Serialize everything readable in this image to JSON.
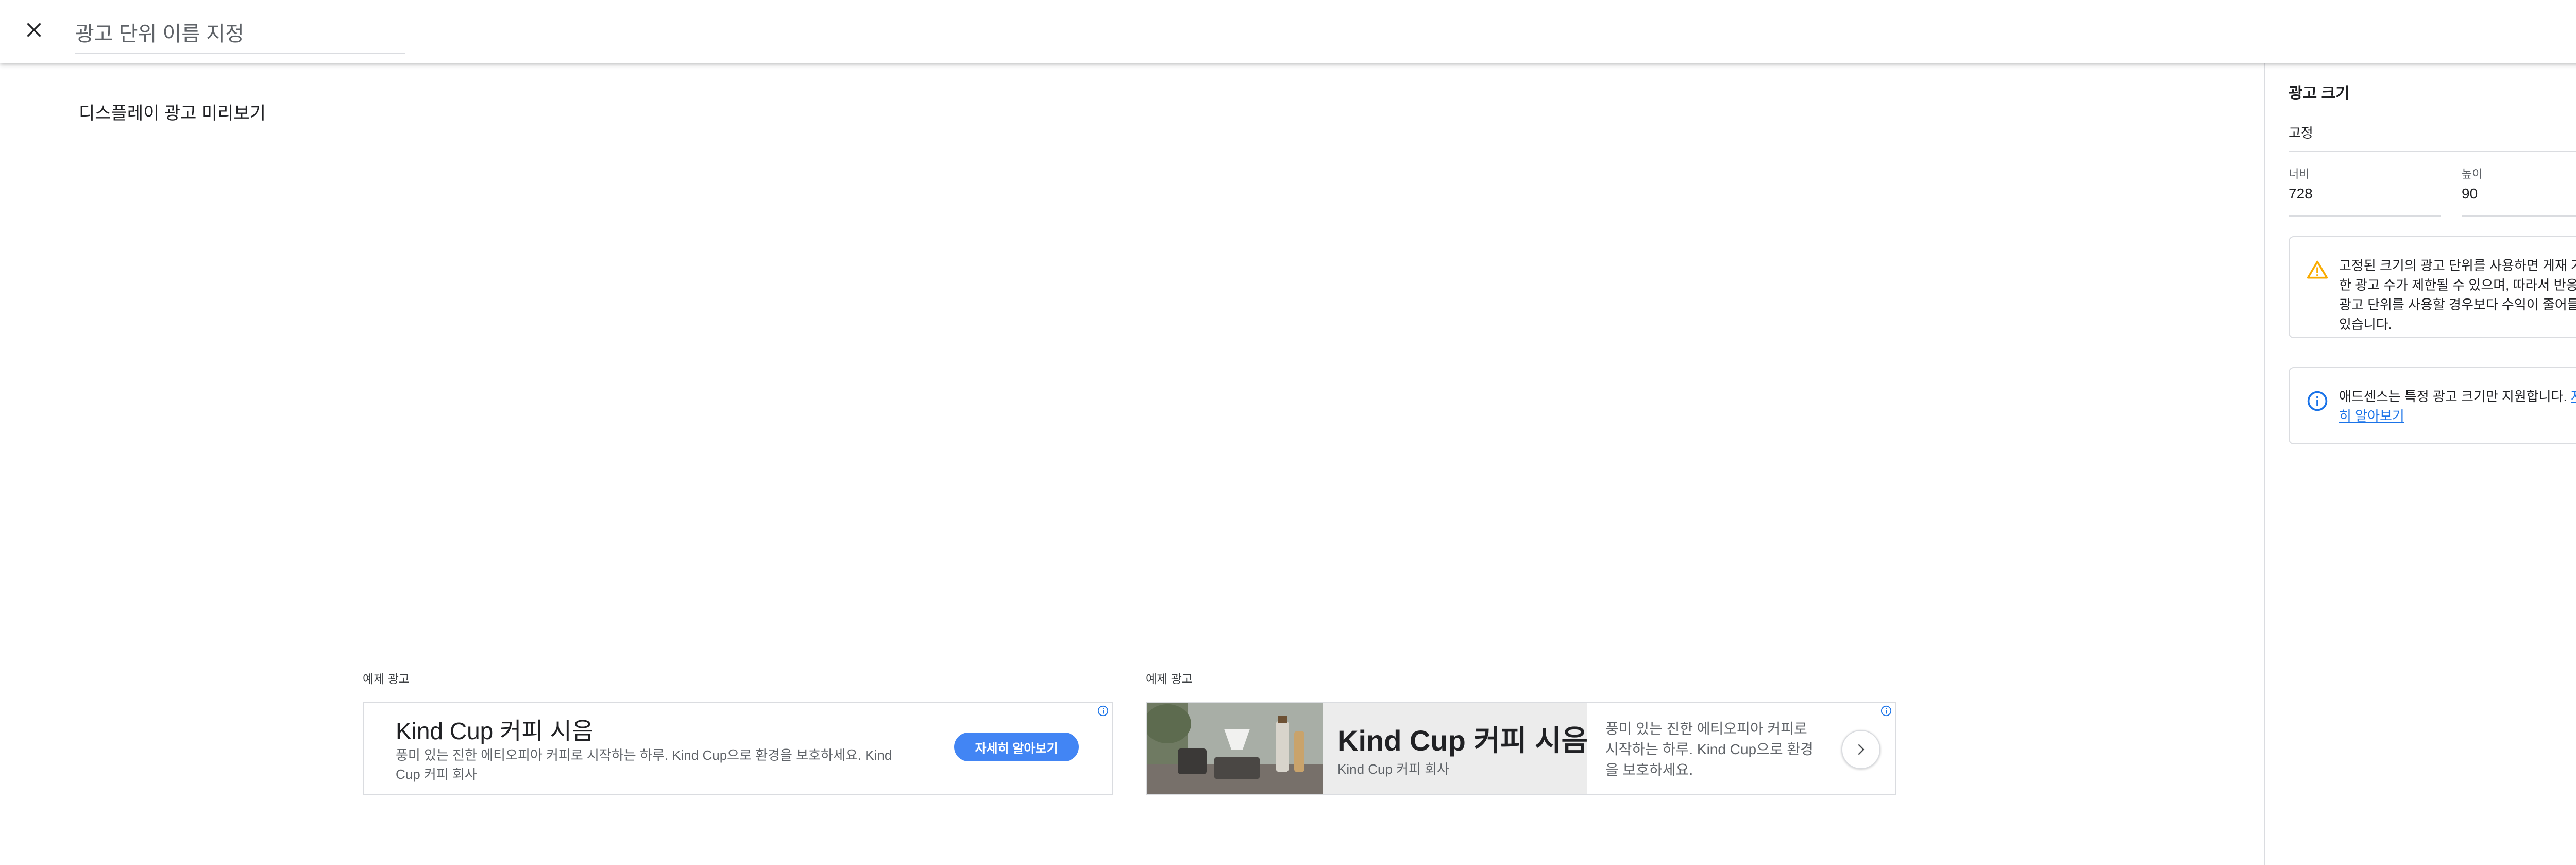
{
  "header": {
    "close_icon": "close-icon",
    "ad_unit_name_placeholder": "광고 단위 이름 지정"
  },
  "preview": {
    "title": "디스플레이 광고 미리보기",
    "sample_ads": [
      {
        "label": "예제 광고",
        "headline": "Kind Cup 커피 시음",
        "description": "풍미 있는 진한 에티오피아 커피로 시작하는 하루. Kind Cup으로 환경을 보호하세요. Kind Cup 커피 회사",
        "cta": "자세히 알아보기",
        "adchoices_icon": "info-icon"
      },
      {
        "label": "예제 광고",
        "headline": "Kind Cup 커피 시음",
        "company": "Kind Cup 커피 회사",
        "description": "풍미 있는 진한 에티오피아 커피로 시작하는 하루. Kind Cup으로 환경을 보호하세요.",
        "next_icon": "chevron-right-icon",
        "adchoices_icon": "info-icon"
      }
    ]
  },
  "panel": {
    "title": "광고 크기",
    "size_type": {
      "value": "고정",
      "options_icon": "dropdown-arrow-icon"
    },
    "width": {
      "label": "너비",
      "value": "728"
    },
    "height": {
      "label": "높이",
      "value": "90"
    },
    "warning": {
      "icon": "warning-icon",
      "text": "고정된 크기의 광고 단위를 사용하면 게재 가능한 광고 수가 제한될 수 있으며, 따라서 반응형 광고 단위를 사용할 경우보다 수익이 줄어들 수 있습니다."
    },
    "info": {
      "icon": "info-icon",
      "text": "애드센스는 특정 광고 크기만 지원합니다. ",
      "link": "자세히 알아보기"
    }
  },
  "colors": {
    "accent_blue": "#1a73e8",
    "cta_blue": "#4285f4",
    "warning_amber": "#f9ab00",
    "border": "#dadce0"
  }
}
